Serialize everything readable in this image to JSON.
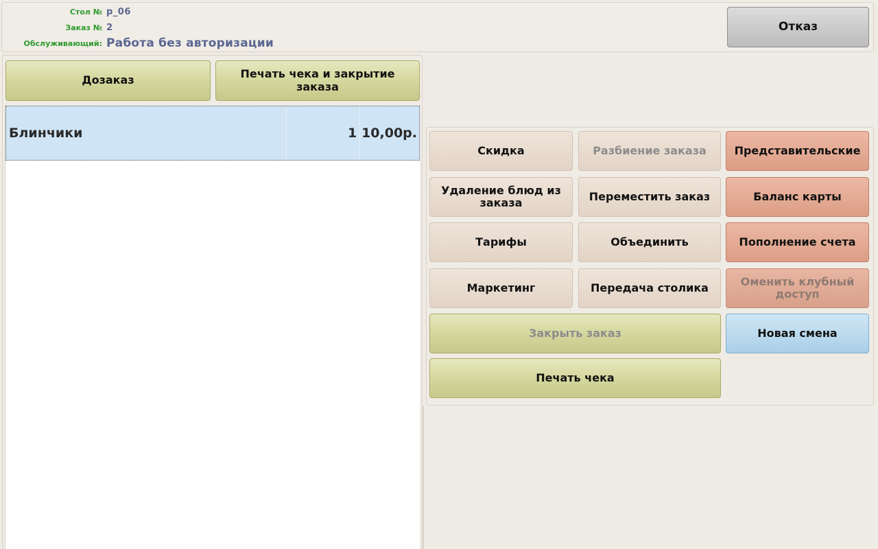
{
  "header": {
    "table_label": "Стол №",
    "table_value": "р_06",
    "order_label": "Заказ №",
    "order_value": "2",
    "waiter_label": "Обслуживающий:",
    "waiter_value": "Работа без авторизации",
    "cancel_label": "Отказ"
  },
  "left": {
    "reorder_label": "Дозаказ",
    "print_close_label": "Печать чека и закрытие заказа"
  },
  "order_items": [
    {
      "name": "Блинчики",
      "qty": "1",
      "price": "10,00р."
    }
  ],
  "actions": {
    "discount": "Скидка",
    "split_order": "Разбиение заказа",
    "representative": "Представительские",
    "remove_dishes": "Удаление блюд из заказа",
    "move_order": "Переместить заказ",
    "card_balance": "Баланс карты",
    "tariffs": "Тарифы",
    "merge": "Объединить",
    "top_up": "Пополнение счета",
    "marketing": "Маркетинг",
    "transfer_table": "Передача столика",
    "cancel_club": "Оменить клубный доступ",
    "close_order": "Закрыть заказ",
    "new_shift": "Новая смена",
    "print_receipt": "Печать чека"
  },
  "colors": {
    "olive": "#cfd294",
    "beige": "#e8dacd",
    "salmon": "#e1a48c",
    "blue": "#b8dbef",
    "selected_row": "#cfe4f5",
    "label_green": "#2e9a2e",
    "value_blue": "#5b6690"
  }
}
